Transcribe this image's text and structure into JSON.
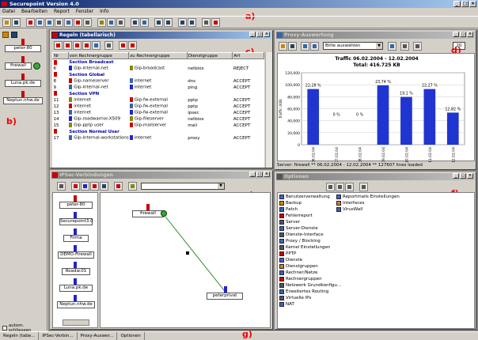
{
  "app": {
    "title": "Securepoint Version 4.0"
  },
  "menu": [
    "Datei",
    "Bearbeiten",
    "Report",
    "Fenster",
    "Info"
  ],
  "markers": {
    "a": "a)",
    "b": "b)",
    "c": "c)",
    "d": "d)",
    "e": "e)",
    "f": "f)",
    "g": "g)"
  },
  "sidebar": {
    "nodes": [
      "peter-80",
      "firewall",
      "Luna.pk.de",
      "Neptun.nhw.de"
    ],
    "autoclose": "autom. schliessen"
  },
  "rules": {
    "title": "Regeln (tabellarisch)",
    "columns": [
      "Nr",
      "von Rechnergruppe",
      "zu Rechnergruppe",
      "Dienstgruppe",
      "Art"
    ],
    "rows": [
      {
        "type": "section",
        "label": "Section Broadcast"
      },
      {
        "nr": "6",
        "from": "Gip-internal-net",
        "to": "Gip-broadcast",
        "service": "netbios",
        "action": "REJECT"
      },
      {
        "type": "section",
        "label": "Section Global"
      },
      {
        "nr": "8",
        "from": "Gip-nameserver",
        "to": "internet",
        "service": "dns",
        "action": "ACCEPT"
      },
      {
        "nr": "9",
        "from": "Gip-internal-net",
        "to": "internet",
        "service": "ping",
        "action": "ACCEPT"
      },
      {
        "type": "section",
        "label": "Section VPN"
      },
      {
        "nr": "11",
        "from": "internet",
        "to": "Gip-fw-external",
        "service": "pptp",
        "action": "ACCEPT"
      },
      {
        "nr": "12",
        "from": "internet",
        "to": "Gip-fw-external",
        "service": "pptp",
        "action": "ACCEPT"
      },
      {
        "nr": "13",
        "from": "internet",
        "to": "Gip-fw-external",
        "service": "ipsec",
        "action": "ACCEPT"
      },
      {
        "nr": "14",
        "from": "Gip-roadwarrior-X509",
        "to": "Gip-fileserver",
        "service": "netbios",
        "action": "ACCEPT"
      },
      {
        "nr": "15",
        "from": "Gip-pptp user",
        "to": "Gip-mailserver",
        "service": "mail",
        "action": "ACCEPT"
      },
      {
        "type": "section",
        "label": "Section Normal User"
      },
      {
        "nr": "17",
        "from": "Gip-internal-workstations",
        "to": "internet",
        "service": "proxy",
        "action": "ACCEPT"
      }
    ]
  },
  "proxy": {
    "title": "Proxy-Auswertung",
    "select": "Bitte auswählen",
    "count": "20",
    "status": "Server: firewall ** 06.02.2004 - 12.02.2004 ** 127607 lines loaded"
  },
  "chart_data": {
    "type": "bar",
    "title": "Traffic 06.02.2004 - 12.02.2004",
    "subtitle": "Total: 416.725 KB",
    "ylabel": "Traffic (KB)",
    "categories": [
      "06.02.04",
      "07.02.04",
      "08.02.04",
      "09.02.04",
      "10.02.04",
      "11.02.04",
      "12.02.04"
    ],
    "values": [
      92800,
      0,
      0,
      99000,
      79600,
      92800,
      53500
    ],
    "data_labels": [
      "22,28 %",
      "0 %",
      "0 %",
      "23,74 %",
      "19,1 %",
      "22,27 %",
      "12,82 %"
    ],
    "yticks": [
      "0",
      "20,000",
      "40,000",
      "60,000",
      "80,000",
      "100,000",
      "120,000"
    ],
    "ylim": [
      0,
      120000
    ],
    "grid": true,
    "color": "#2035d0"
  },
  "ipsec": {
    "title": "IPSec-Verbindungen",
    "nodes": [
      "peter-80",
      "Securepoint3.0",
      "Firma",
      "DEMO-Firewall",
      "Roadw.01",
      "Luna.pk.de",
      "Neptun.nhw.de"
    ],
    "graph": {
      "source": "firewall",
      "target": "peterprivat"
    }
  },
  "options": {
    "title": "Optionen",
    "left": [
      "Benutzerverwaltung",
      "Backup",
      "Patch",
      "Fehlerreport",
      "Server",
      "Server-Dienste",
      "Dienste-Interface",
      "Proxy / Blocking",
      "Kernel Einstellungen",
      "PPTP",
      "Dienste",
      "Dienstgruppen",
      "Rechner/Netze",
      "Rechnergruppen",
      "Netzwerk Grundkonfigu...",
      "Erweitertes Routing",
      "Virtuelle IPs",
      "NAT"
    ],
    "right": [
      "Reportmails Einstellungen",
      "Interfaces",
      "VirusWall"
    ]
  },
  "taskbar": [
    "Regeln (tabe...",
    "IPSec-Verbin...",
    "Proxy-Auswer...",
    "Optionen"
  ]
}
